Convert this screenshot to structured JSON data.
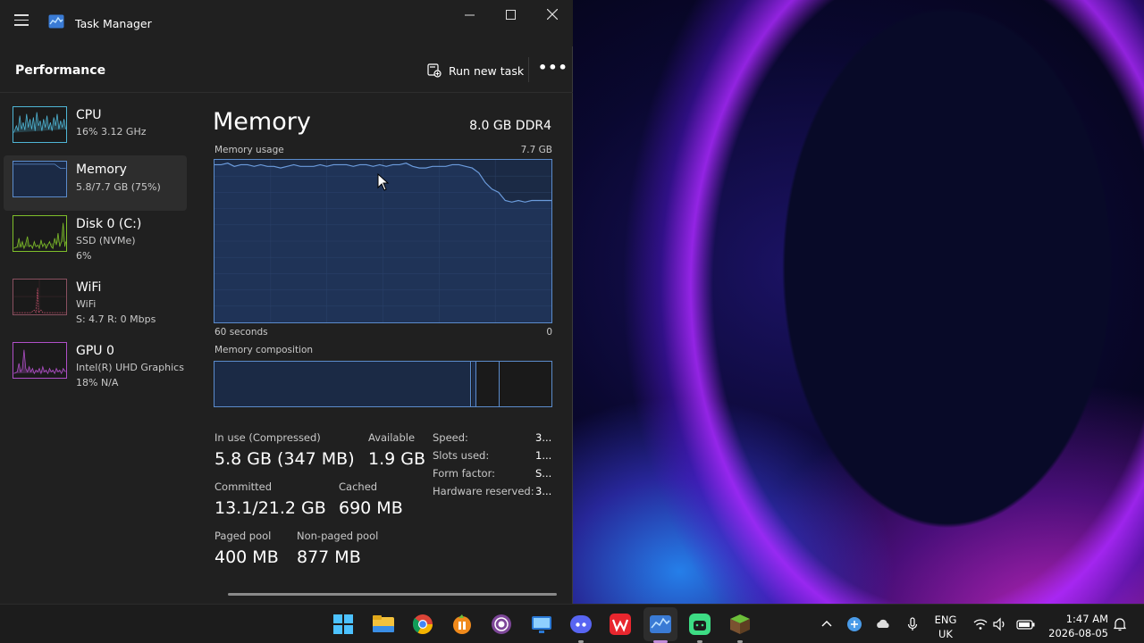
{
  "app": {
    "title": "Task Manager"
  },
  "header": {
    "title": "Performance",
    "run_task_label": "Run new task",
    "more_label": "•••"
  },
  "sidebar": {
    "items": [
      {
        "name": "CPU",
        "line1": "16% 3.12 GHz",
        "line2": "",
        "color": "#4fb6d6"
      },
      {
        "name": "Memory",
        "line1": "5.8/7.7 GB (75%)",
        "line2": "",
        "color": "#5c8ccc"
      },
      {
        "name": "Disk 0 (C:)",
        "line1": "SSD (NVMe)",
        "line2": "6%",
        "color": "#7fbf2a"
      },
      {
        "name": "WiFi",
        "line1": "WiFi",
        "line2": "S: 4.7  R: 0 Mbps",
        "color": "#c0506a"
      },
      {
        "name": "GPU 0",
        "line1": "Intel(R) UHD Graphics",
        "line2": "18%  N/A",
        "color": "#b04fc8"
      }
    ]
  },
  "main": {
    "title": "Memory",
    "type": "8.0 GB DDR4",
    "usage_label": "Memory usage",
    "usage_max": "7.7 GB",
    "time_left": "60 seconds",
    "time_right": "0",
    "composition_label": "Memory composition",
    "usage_history_fraction": [
      0.97,
      0.97,
      0.98,
      0.96,
      0.97,
      0.97,
      0.96,
      0.97,
      0.96,
      0.96,
      0.95,
      0.96,
      0.97,
      0.96,
      0.96,
      0.96,
      0.97,
      0.96,
      0.97,
      0.97,
      0.97,
      0.96,
      0.97,
      0.97,
      0.96,
      0.97,
      0.96,
      0.97,
      0.97,
      0.98,
      0.96,
      0.95,
      0.95,
      0.96,
      0.96,
      0.96,
      0.97,
      0.97,
      0.96,
      0.95,
      0.92,
      0.86,
      0.82,
      0.8,
      0.75,
      0.74,
      0.75,
      0.74,
      0.75,
      0.75,
      0.75,
      0.75
    ],
    "stats": {
      "in_use_label": "In use (Compressed)",
      "in_use_value": "5.8 GB (347 MB)",
      "available_label": "Available",
      "available_value": "1.9 GB",
      "committed_label": "Committed",
      "committed_value": "13.1/21.2 GB",
      "cached_label": "Cached",
      "cached_value": "690 MB",
      "paged_label": "Paged pool",
      "paged_value": "400 MB",
      "nonpaged_label": "Non-paged pool",
      "nonpaged_value": "877 MB"
    },
    "details": [
      {
        "label": "Speed:",
        "value": "3..."
      },
      {
        "label": "Slots used:",
        "value": "1..."
      },
      {
        "label": "Form factor:",
        "value": "S..."
      },
      {
        "label": "Hardware reserved:",
        "value": "3..."
      }
    ]
  },
  "taskbar": {
    "lang1": "ENG",
    "lang2": "UK",
    "time": "1:47 AM",
    "date": "2026-08-05"
  }
}
